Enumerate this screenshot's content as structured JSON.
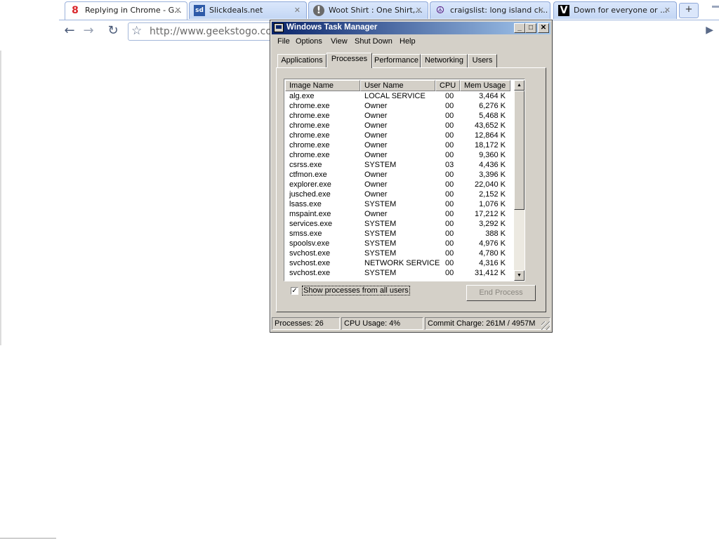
{
  "browser": {
    "tabs": [
      {
        "title": "Replying in Chrome - G...",
        "favicon": "8",
        "active": true
      },
      {
        "title": "Slickdeals.net",
        "favicon": "sd"
      },
      {
        "title": "Woot Shirt : One Shirt,...",
        "favicon": "!"
      },
      {
        "title": "craigslist: long island cl...",
        "favicon": "☮"
      },
      {
        "title": "Down for everyone or ...",
        "favicon": "V"
      }
    ],
    "close_glyph": "✕",
    "new_tab_glyph": "+",
    "url": "http://www.geekstogo.com",
    "icons": {
      "back": "back-arrow-icon",
      "forward": "forward-arrow-icon",
      "reload": "reload-icon",
      "star": "star-icon",
      "page": "play-arrow-icon"
    }
  },
  "task_manager": {
    "title": "Windows Task Manager",
    "title_buttons": {
      "minimize": "_",
      "maximize": "□",
      "close": "✕"
    },
    "menu": [
      "File",
      "Options",
      "View",
      "Shut Down",
      "Help"
    ],
    "tabs": [
      "Applications",
      "Processes",
      "Performance",
      "Networking",
      "Users"
    ],
    "selected_tab": "Processes",
    "columns": [
      "Image Name",
      "User Name",
      "CPU",
      "Mem Usage"
    ],
    "processes": [
      {
        "name": "alg.exe",
        "user": "LOCAL SERVICE",
        "cpu": "00",
        "mem": "3,464 K"
      },
      {
        "name": "chrome.exe",
        "user": "Owner",
        "cpu": "00",
        "mem": "6,276 K"
      },
      {
        "name": "chrome.exe",
        "user": "Owner",
        "cpu": "00",
        "mem": "5,468 K"
      },
      {
        "name": "chrome.exe",
        "user": "Owner",
        "cpu": "00",
        "mem": "43,652 K"
      },
      {
        "name": "chrome.exe",
        "user": "Owner",
        "cpu": "00",
        "mem": "12,864 K"
      },
      {
        "name": "chrome.exe",
        "user": "Owner",
        "cpu": "00",
        "mem": "18,172 K"
      },
      {
        "name": "chrome.exe",
        "user": "Owner",
        "cpu": "00",
        "mem": "9,360 K"
      },
      {
        "name": "csrss.exe",
        "user": "SYSTEM",
        "cpu": "03",
        "mem": "4,436 K"
      },
      {
        "name": "ctfmon.exe",
        "user": "Owner",
        "cpu": "00",
        "mem": "3,396 K"
      },
      {
        "name": "explorer.exe",
        "user": "Owner",
        "cpu": "00",
        "mem": "22,040 K"
      },
      {
        "name": "jusched.exe",
        "user": "Owner",
        "cpu": "00",
        "mem": "2,152 K"
      },
      {
        "name": "lsass.exe",
        "user": "SYSTEM",
        "cpu": "00",
        "mem": "1,076 K"
      },
      {
        "name": "mspaint.exe",
        "user": "Owner",
        "cpu": "00",
        "mem": "17,212 K"
      },
      {
        "name": "services.exe",
        "user": "SYSTEM",
        "cpu": "00",
        "mem": "3,292 K"
      },
      {
        "name": "smss.exe",
        "user": "SYSTEM",
        "cpu": "00",
        "mem": "388 K"
      },
      {
        "name": "spoolsv.exe",
        "user": "SYSTEM",
        "cpu": "00",
        "mem": "4,976 K"
      },
      {
        "name": "svchost.exe",
        "user": "SYSTEM",
        "cpu": "00",
        "mem": "4,780 K"
      },
      {
        "name": "svchost.exe",
        "user": "NETWORK SERVICE",
        "cpu": "00",
        "mem": "4,316 K"
      },
      {
        "name": "svchost.exe",
        "user": "SYSTEM",
        "cpu": "00",
        "mem": "31,412 K"
      }
    ],
    "show_all_users": {
      "label": "Show processes from all users",
      "checked": true,
      "check_glyph": "✓"
    },
    "end_process_label": "End Process",
    "status": {
      "processes": "Processes: 26",
      "cpu": "CPU Usage: 4%",
      "commit": "Commit Charge: 261M / 4957M"
    },
    "scroll_glyphs": {
      "up": "▲",
      "down": "▼"
    }
  },
  "colors": {
    "title_start": "#0a246a",
    "title_end": "#a6caf0",
    "face": "#d4d0c8",
    "chrome_tab": "#dbe7fb"
  }
}
